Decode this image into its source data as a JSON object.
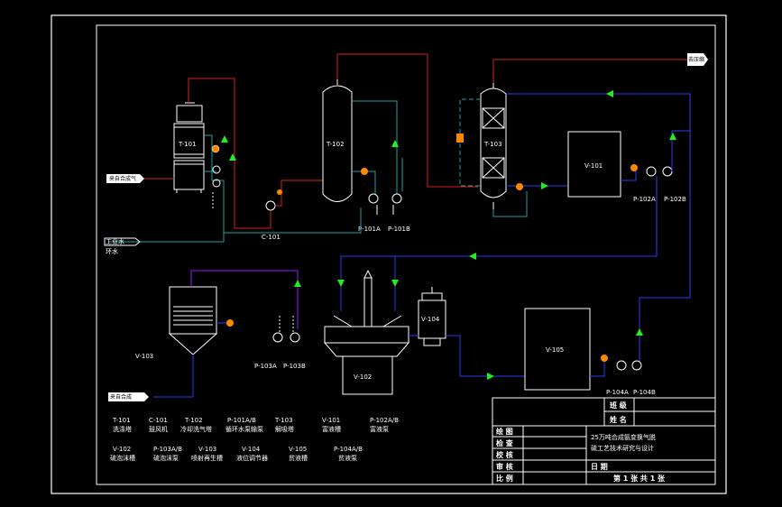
{
  "equipment_labels": {
    "t101": "T-101",
    "t102": "T-102",
    "t103": "T-103",
    "c101": "C-101",
    "p101a": "P-101A",
    "p101b": "P-101B",
    "v101": "V-101",
    "p102a": "P-102A",
    "p102b": "P-102B",
    "v103": "V-103",
    "p103a": "P-103A",
    "p103b": "P-103B",
    "v102": "V-102",
    "v104": "V-104",
    "v105": "V-105",
    "p104a": "P-104A",
    "p104b": "P-104B"
  },
  "stream_labels": {
    "feed_in": "来自合成气",
    "water_in": "工业水",
    "water_loop": "环水",
    "gas_out": "去压缩",
    "bottom_feed": "来自合成"
  },
  "legend": [
    {
      "tag": "T-101",
      "name": "洗涤塔"
    },
    {
      "tag": "C-101",
      "name": "鼓风机"
    },
    {
      "tag": "T-102",
      "name": "冷却洗气塔"
    },
    {
      "tag": "P-101A/B",
      "name": "循环水泵输泵"
    },
    {
      "tag": "T-103",
      "name": "解吸塔"
    },
    {
      "tag": "V-101",
      "name": "富液槽"
    },
    {
      "tag": "P-102A/B",
      "name": "富液泵"
    },
    {
      "tag": "V-102",
      "name": "硫泡沫槽"
    },
    {
      "tag": "P-103A/B",
      "name": "硫泡沫泵"
    },
    {
      "tag": "V-103",
      "name": "喷射再生槽"
    },
    {
      "tag": "V-104",
      "name": "液位调节器"
    },
    {
      "tag": "V-105",
      "name": "贫液槽"
    },
    {
      "tag": "P-104A/B",
      "name": "贫液泵"
    }
  ],
  "title_block": {
    "class_label": "班 级",
    "name_label": "姓 名",
    "draw_label": "绘 图",
    "check_label": "检 查",
    "proof_label": "校 核",
    "review_label": "审 核",
    "scale_label": "比 例",
    "title_line1": "25万吨合成氨变换气脱",
    "title_line2": "硫工艺技术研究与设计",
    "date_label": "日 期",
    "sheet_label": "第 1 张   共 1 张"
  },
  "colors": {
    "background": "#000000",
    "frame": "#ffffff",
    "gas_line": "#d42020",
    "water_line": "#2a3cf0",
    "cooling_line": "#20a0a0",
    "solution_line": "#9a1aff",
    "steam_line": "#30e030",
    "arrow": "#22ee22",
    "valve_orange": "#ff8800"
  }
}
